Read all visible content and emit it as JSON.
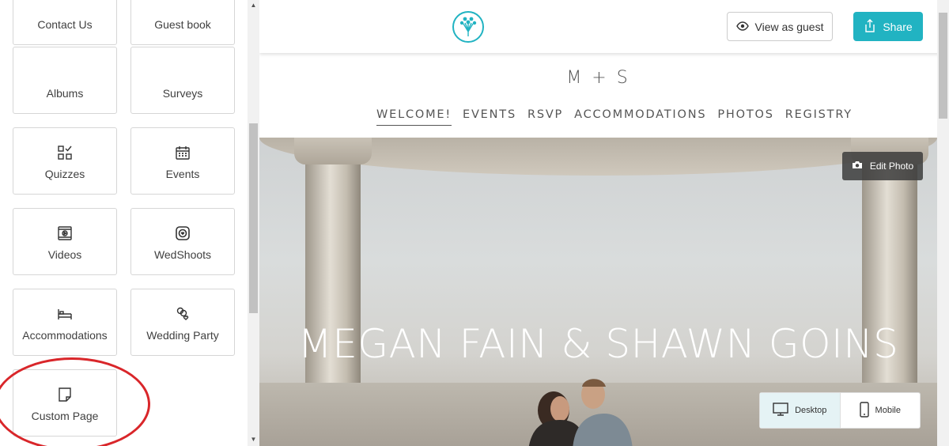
{
  "sidebar": {
    "tiles": [
      {
        "label": "Contact Us",
        "icon": "none"
      },
      {
        "label": "Guest book",
        "icon": "none"
      },
      {
        "label": "Albums",
        "icon": "none"
      },
      {
        "label": "Surveys",
        "icon": "none"
      },
      {
        "label": "Quizzes",
        "icon": "grid-check-icon"
      },
      {
        "label": "Events",
        "icon": "calendar-icon"
      },
      {
        "label": "Videos",
        "icon": "video-icon"
      },
      {
        "label": "WedShoots",
        "icon": "camera-heart-icon"
      },
      {
        "label": "Accommodations",
        "icon": "bed-icon"
      },
      {
        "label": "Wedding Party",
        "icon": "people-heart-icon"
      },
      {
        "label": "Custom Page",
        "icon": "page-icon"
      }
    ],
    "highlight_color": "#d9262a"
  },
  "topbar": {
    "view_as_guest": "View as guest",
    "share": "Share",
    "accent_color": "#21b3c2"
  },
  "site": {
    "monogram": "M + S",
    "nav": [
      "WELCOME!",
      "EVENTS",
      "RSVP",
      "ACCOMMODATIONS",
      "PHOTOS",
      "REGISTRY"
    ],
    "active_nav": "WELCOME!",
    "headline": "MEGAN FAIN & SHAWN GOINS",
    "edit_photo": "Edit Photo"
  },
  "device_toggle": {
    "desktop": "Desktop",
    "mobile": "Mobile",
    "active": "Desktop"
  }
}
